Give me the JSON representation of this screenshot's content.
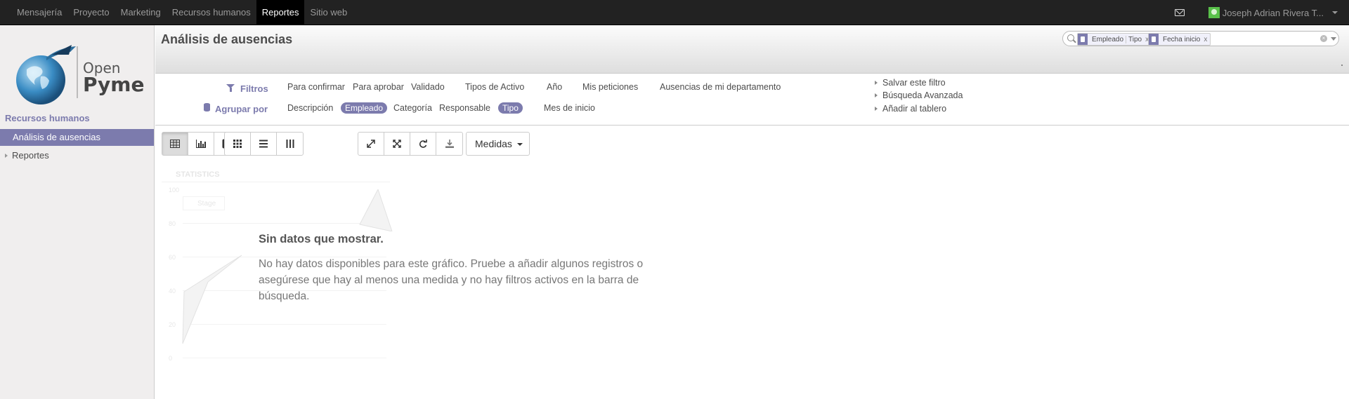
{
  "topbar": {
    "menu": [
      "Mensajería",
      "Proyecto",
      "Marketing",
      "Recursos humanos",
      "Reportes",
      "Sitio web"
    ],
    "active_menu": "Reportes",
    "user_name": "Joseph Adrian Rivera T...",
    "mail_icon": "envelope-icon",
    "avatar_color": "#59c04a"
  },
  "sidebar": {
    "logo": {
      "line1": "Open",
      "line2": "Pyme"
    },
    "section_title": "Recursos humanos",
    "items": [
      {
        "label": "Análisis de ausencias",
        "active": true
      },
      {
        "label": "Reportes",
        "active": false
      }
    ],
    "accent_color": "#7c7bad"
  },
  "header": {
    "title": "Análisis de ausencias",
    "search": {
      "facets": [
        {
          "values": [
            "Empleado",
            "Tipo"
          ],
          "remove": "x"
        },
        {
          "values": [
            "Fecha inicio"
          ],
          "remove": "x"
        }
      ]
    }
  },
  "filters": {
    "filters_label": "Filtros",
    "group_label": "Agrupar por",
    "filter_options": [
      "Para confirmar",
      "Para aprobar",
      "Validado",
      "Tipos de Activo",
      "Año",
      "Mis peticiones",
      "Ausencias de mi departamento"
    ],
    "group_options": [
      "Descripción",
      "Empleado",
      "Categoría",
      "Responsable",
      "Tipo",
      "Mes de inicio"
    ],
    "selected_groups": [
      "Empleado",
      "Tipo"
    ],
    "side_links": [
      "Salvar este filtro",
      "Búsqueda Avanzada",
      "Añadir al tablero"
    ]
  },
  "toolbar": {
    "view_buttons": [
      "table-icon",
      "bar-chart-icon",
      "line-chart-icon",
      "pie-chart-icon"
    ],
    "layout_buttons": [
      "grid-icon",
      "list-icon",
      "columns-icon"
    ],
    "action_buttons": [
      "expand-icon",
      "collapse-icon",
      "refresh-icon",
      "download-icon"
    ],
    "measures_label": "Medidas"
  },
  "ghost_chart": {
    "title": "STATISTICS",
    "legend": "Stage",
    "ticks": [
      "100",
      "80",
      "60",
      "40",
      "20",
      "0"
    ]
  },
  "nodata": {
    "title": "Sin datos que mostrar.",
    "body": "No hay datos disponibles para este gráfico. Pruebe a añadir algunos registros o asegúrese que hay al menos una medida y no hay filtros activos en la barra de búsqueda."
  }
}
